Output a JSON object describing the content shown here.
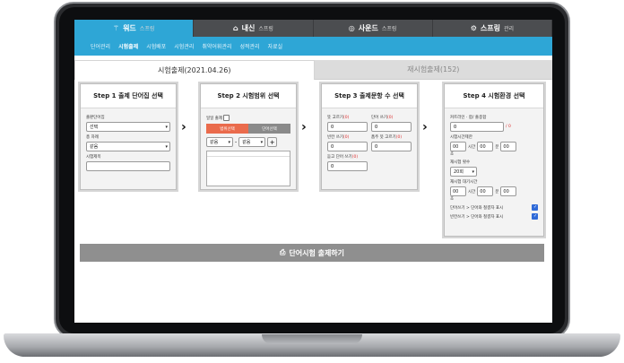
{
  "top_nav": [
    {
      "icon": "book-icon",
      "glyph": "⚚",
      "name": "워드",
      "sub": "스프링"
    },
    {
      "icon": "building-icon",
      "glyph": "⌂",
      "name": "내신",
      "sub": "스프링"
    },
    {
      "icon": "speaker-icon",
      "glyph": "◎",
      "name": "사운드",
      "sub": "스프링"
    },
    {
      "icon": "gear-icon",
      "glyph": "⚙",
      "name": "스프링",
      "sub": "관리"
    }
  ],
  "sub_nav": [
    "단어관리",
    "시험출제",
    "시험배포",
    "시험관리",
    "취약어휘관리",
    "성적관리",
    "자료실"
  ],
  "exam_tabs": {
    "active": "시험출제(2021.04.26)",
    "inactive": "재시험출제(152)"
  },
  "step1": {
    "title": "Step 1 출제 단어집 선택",
    "label_publisher": "출판단어집",
    "publisher_value": "선택",
    "label_chapter": "총 차례",
    "chapter_value": "같음",
    "label_exam_title": "시험제목",
    "exam_title_value": ""
  },
  "step2": {
    "title": "Step 2 시험범위 선택",
    "label_period": "일일 출제",
    "seg_on": "범위선택",
    "seg_off": "단어선택",
    "range_from": "같음",
    "range_to": "같음",
    "plus": "+"
  },
  "step3": {
    "title": "Step 3 출제문항 수 선택",
    "fields": [
      {
        "label": "뜻 고르기",
        "value": "0"
      },
      {
        "label": "단어 쓰기",
        "value": "0"
      },
      {
        "label": "빈칸 쓰기",
        "value": "0"
      },
      {
        "label": "품주 뜻 고르기",
        "value": "0"
      },
      {
        "label": "듣고 단어 쓰기",
        "value": "0"
      }
    ],
    "badge": "(0)"
  },
  "step4": {
    "title": "Step 4 시험환경 선택",
    "label_pass": "커트라인 · 합/ 출종합",
    "pass_value": "0",
    "pass_unit": "/ 0",
    "label_time": "시험시간제한",
    "time": {
      "h": "00",
      "m": "00",
      "s": "00"
    },
    "unit_h": "시간",
    "unit_m": "분",
    "unit_s": "초",
    "label_retry": "재시험 횟수",
    "retry_value": "20회",
    "label_wait": "재시험 대기시간",
    "wait": {
      "h": "00",
      "m": "00",
      "s": "00"
    },
    "check1": "단어쓰기 > 단어와 철결자 표시",
    "check2": "빈칸쓰기 > 단어와 철결자 표시"
  },
  "submit": {
    "icon": "printer-icon",
    "label": "단어시험 출제하기"
  }
}
